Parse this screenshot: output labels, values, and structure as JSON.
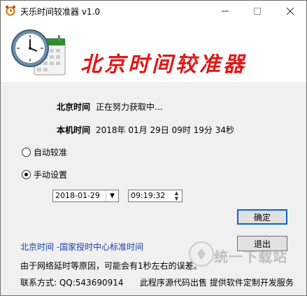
{
  "window": {
    "title": "天乐时间较准器 v1.0",
    "icons": [
      "alarm-clock-icon",
      "minimize-icon",
      "maximize-icon",
      "close-icon"
    ]
  },
  "header": {
    "banner_text": "北京时间较准器",
    "banner_color": "#e01818"
  },
  "beijing_time": {
    "label": "北京时间",
    "value": "正在努力获取中..."
  },
  "local_time": {
    "label": "本机时间",
    "value": "2018年 01月 29日  09时 19分 34秒"
  },
  "mode": {
    "auto_label": "自动较准",
    "manual_label": "手动设置",
    "selected": "manual"
  },
  "manual": {
    "date_value": "2018-01-29",
    "time_value": "09:19:32"
  },
  "buttons": {
    "confirm": "确定",
    "exit": "退出"
  },
  "footer": {
    "source_link": "北京时间 -国家授时中心标准时间",
    "note": "由于网络延时等原因，可能会有1秒左右的误差。",
    "contact": "联系方式:  QQ:543690914",
    "services": "此程序源代码出售  提供软件定制开发服务"
  },
  "watermark": {
    "text": "统一下载站"
  },
  "colors": {
    "accent_blue": "#1a3ea8",
    "default_button_border": "#0a64d8"
  }
}
